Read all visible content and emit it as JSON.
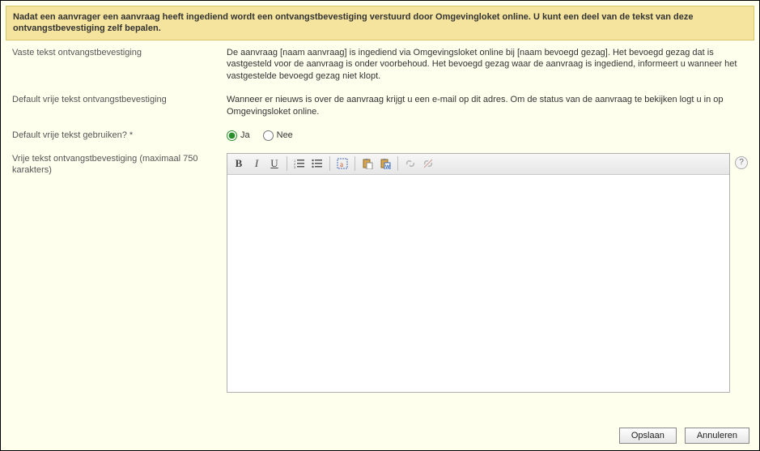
{
  "banner": "Nadat een aanvrager een aanvraag heeft ingediend wordt een ontvangstbevestiging verstuurd door Omgevingloket online. U kunt een deel van de tekst van deze ontvangstbevestiging zelf bepalen.",
  "rows": {
    "fixed": {
      "label": "Vaste tekst ontvangstbevestiging",
      "value": "De aanvraag [naam aanvraag] is ingediend via Omgevingsloket online bij [naam bevoegd gezag]. Het bevoegd gezag dat is vastgesteld voor de aanvraag is onder voorbehoud. Het bevoegd gezag waar de aanvraag is ingediend, informeert u wanneer het vastgestelde bevoegd gezag niet klopt."
    },
    "default_free": {
      "label": "Default vrije tekst ontvangstbevestiging",
      "value": "Wanneer er nieuws is over de aanvraag krijgt u een e-mail op dit adres. Om de status van de aanvraag te bekijken logt u in op Omgevingsloket online."
    },
    "use_default": {
      "label": "Default vrije tekst gebruiken? *",
      "options": {
        "yes": "Ja",
        "no": "Nee"
      },
      "selected": "yes"
    },
    "free_text": {
      "label": "Vrije tekst ontvangstbevestiging (maximaal 750 karakters)",
      "value": ""
    }
  },
  "toolbar": {
    "bold": "B",
    "italic": "I",
    "underline": "U"
  },
  "help": "?",
  "buttons": {
    "save": "Opslaan",
    "cancel": "Annuleren"
  }
}
